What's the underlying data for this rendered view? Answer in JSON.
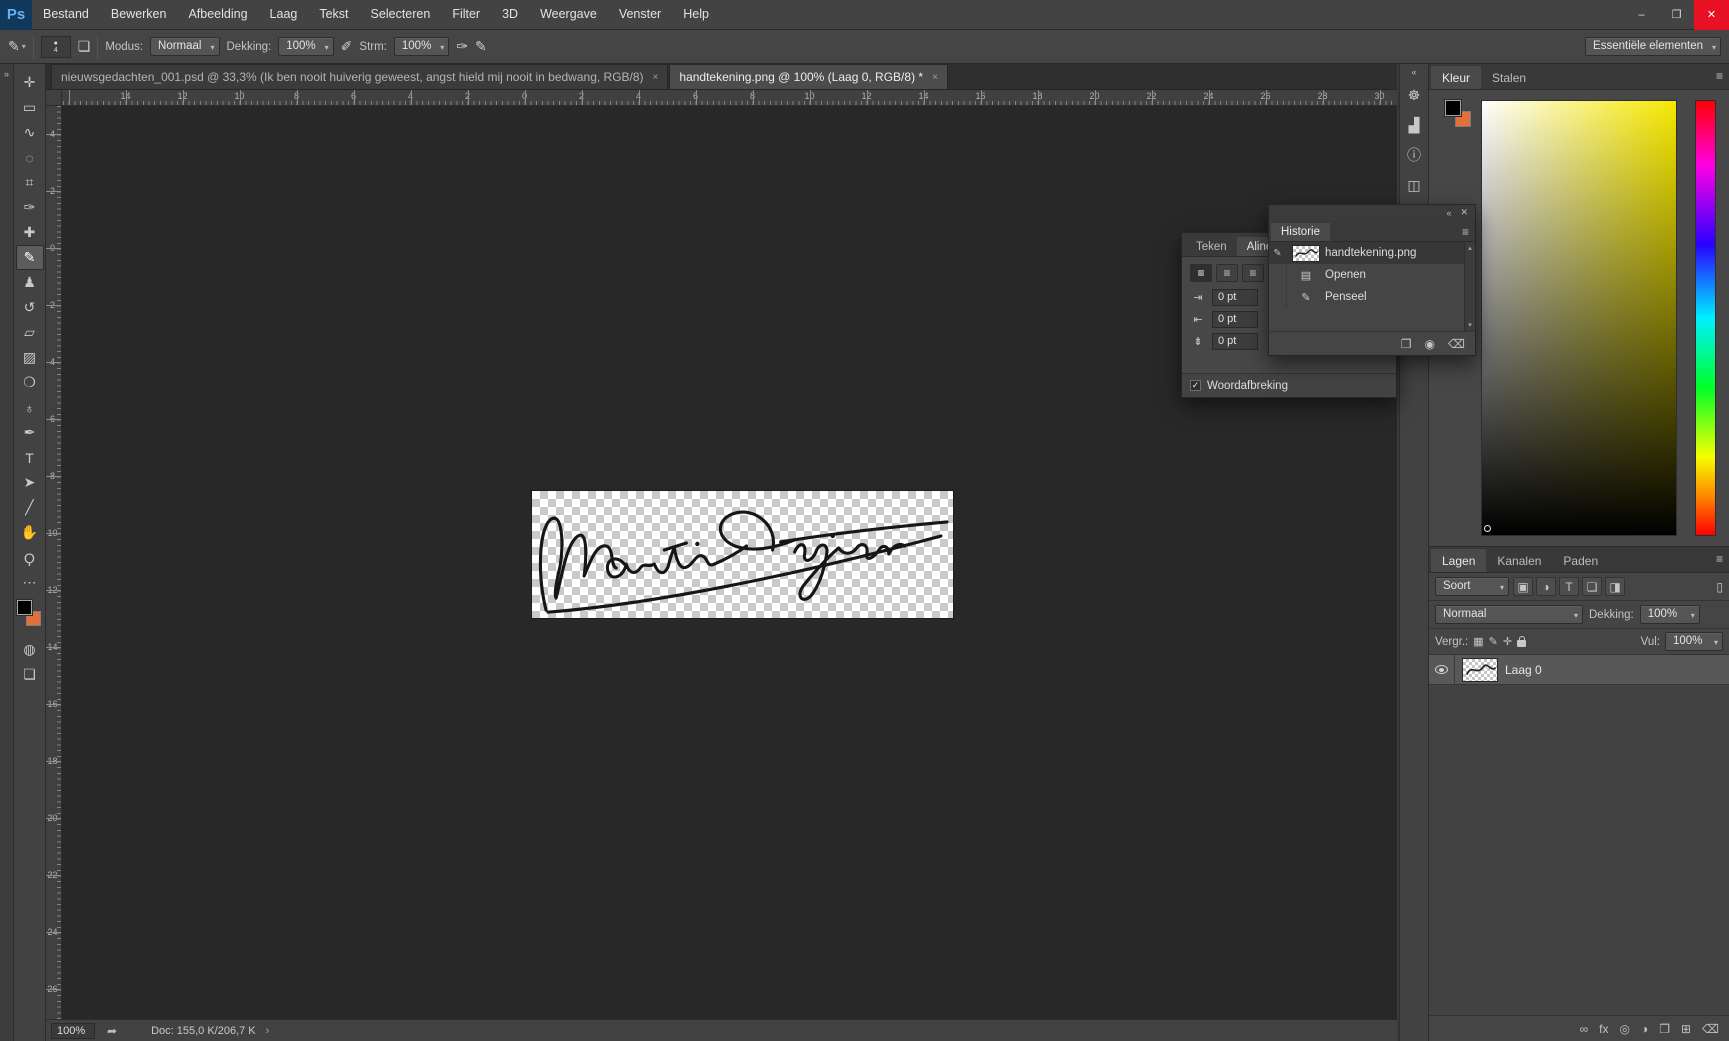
{
  "window": {
    "logo": "Ps",
    "minimize": "–",
    "maximize": "❐",
    "close": "✕"
  },
  "menubar": {
    "items": [
      "Bestand",
      "Bewerken",
      "Afbeelding",
      "Laag",
      "Tekst",
      "Selecteren",
      "Filter",
      "3D",
      "Weergave",
      "Venster",
      "Help"
    ]
  },
  "options_bar": {
    "tool_icon": "✎",
    "dropdown_arrow": "▾",
    "brush_tip_dot": "●",
    "brush_size": "4",
    "panel_toggle_icon": "❏",
    "mode_label": "Modus:",
    "mode_value": "Normaal",
    "opacity_label": "Dekking:",
    "opacity_value": "100%",
    "tablet_opacity_icon": "✐",
    "flow_label": "Strm:",
    "flow_value": "100%",
    "airbrush_icon": "✑",
    "tablet_size_icon": "✎",
    "workspace_value": "Essentiële elementen"
  },
  "document_tabs": [
    {
      "label": "nieuwsgedachten_001.psd @ 33,3% (Ik ben nooit huiverig geweest, angst hield mij nooit in bedwang, RGB/8)",
      "close": "×",
      "active": false
    },
    {
      "label": "handtekening.png @ 100% (Laag 0, RGB/8) *",
      "close": "×",
      "active": true
    }
  ],
  "rulers": {
    "horizontal": [
      "14",
      "12",
      "10",
      "8",
      "6",
      "4",
      "2",
      "0",
      "2",
      "4",
      "6",
      "8",
      "10",
      "12",
      "14",
      "16",
      "18",
      "20",
      "22",
      "24",
      "26",
      "28",
      "30"
    ],
    "vertical": [
      "4",
      "2",
      "0",
      "2",
      "4",
      "6",
      "8",
      "10",
      "12",
      "14",
      "16",
      "18",
      "20",
      "22",
      "24",
      "26"
    ]
  },
  "panel_strips": {
    "left_expand": "»",
    "right_collapse": "«"
  },
  "tools": [
    {
      "name": "move-tool",
      "glyph": "✛"
    },
    {
      "name": "marquee-tool",
      "glyph": "▭"
    },
    {
      "name": "lasso-tool",
      "glyph": "∿"
    },
    {
      "name": "quick-selection-tool",
      "glyph": "◌"
    },
    {
      "name": "crop-tool",
      "glyph": "⌗"
    },
    {
      "name": "eyedropper-tool",
      "glyph": "✑"
    },
    {
      "name": "healing-brush-tool",
      "glyph": "✚"
    },
    {
      "name": "brush-tool",
      "glyph": "✎",
      "active": true
    },
    {
      "name": "clone-stamp-tool",
      "glyph": "♟"
    },
    {
      "name": "history-brush-tool",
      "glyph": "↺"
    },
    {
      "name": "eraser-tool",
      "glyph": "▱"
    },
    {
      "name": "gradient-tool",
      "glyph": "▨"
    },
    {
      "name": "blur-tool",
      "glyph": "❍"
    },
    {
      "name": "dodge-tool",
      "glyph": "♁"
    },
    {
      "name": "pen-tool",
      "glyph": "✒"
    },
    {
      "name": "type-tool",
      "glyph": "T"
    },
    {
      "name": "path-selection-tool",
      "glyph": "➤"
    },
    {
      "name": "line-tool",
      "glyph": "╱"
    },
    {
      "name": "hand-tool",
      "glyph": "✋"
    },
    {
      "name": "zoom-tool",
      "glyph": "Ϙ"
    },
    {
      "name": "edit-toolbar-button",
      "glyph": "⋯"
    }
  ],
  "tools_bottom": [
    {
      "name": "quick-mask-button",
      "glyph": "◍"
    },
    {
      "name": "screen-mode-button",
      "glyph": "❏"
    }
  ],
  "colors": {
    "foreground": "#000000",
    "background": "#e2703a",
    "close_button": "#e81123",
    "canvas": "#282828"
  },
  "dock_icons": [
    {
      "name": "navigator-panel-icon",
      "glyph": "☸"
    },
    {
      "name": "histogram-panel-icon",
      "glyph": "▟"
    },
    {
      "name": "info-panel-icon",
      "glyph": "ⓘ"
    },
    {
      "name": "properties-panel-icon",
      "glyph": "◫"
    }
  ],
  "color_panel": {
    "tabs": [
      {
        "label": "Kleur",
        "active": true
      },
      {
        "label": "Stalen"
      }
    ],
    "menu_icon": "≡",
    "hue_color": "#f6e800"
  },
  "layers_panel": {
    "tabs": [
      {
        "label": "Lagen",
        "active": true
      },
      {
        "label": "Kanalen"
      },
      {
        "label": "Paden"
      }
    ],
    "menu_icon": "≡",
    "filter_label": "Soort",
    "dropdown_arrow": "▾",
    "filter_icons": [
      {
        "name": "filter-pixel-layers-icon",
        "glyph": "▣"
      },
      {
        "name": "filter-adjustment-layers-icon",
        "glyph": "◑"
      },
      {
        "name": "filter-type-layers-icon",
        "glyph": "T"
      },
      {
        "name": "filter-shape-layers-icon",
        "glyph": "❏"
      },
      {
        "name": "filter-smart-objects-icon",
        "glyph": "◨"
      }
    ],
    "filter_toggle_icon": "▯",
    "blend_mode_value": "Normaal",
    "opacity_label": "Dekking:",
    "opacity_value": "100%",
    "lock_label": "Vergr.:",
    "lock_glyphs": [
      "▦",
      "✎",
      "✛"
    ],
    "fill_label": "Vul:",
    "fill_value": "100%",
    "layers": [
      {
        "name": "Laag 0"
      }
    ],
    "bottom_buttons": [
      {
        "name": "link-layers-button",
        "glyph": "∞"
      },
      {
        "name": "layer-effects-button",
        "glyph": "fx"
      },
      {
        "name": "layer-mask-button",
        "glyph": "◎"
      },
      {
        "name": "adjustment-layer-button",
        "glyph": "◑"
      },
      {
        "name": "layer-group-button",
        "glyph": "❐"
      },
      {
        "name": "new-layer-button",
        "glyph": "⊞"
      },
      {
        "name": "delete-layer-button",
        "glyph": "⌫"
      }
    ]
  },
  "paragraph_panel": {
    "tabs": [
      {
        "label": "Teken"
      },
      {
        "label": "Alinea",
        "active": true
      }
    ],
    "align_buttons": [
      {
        "name": "align-left-button",
        "glyph": "≡",
        "active": true
      },
      {
        "name": "align-center-button",
        "glyph": "≡"
      },
      {
        "name": "align-right-button",
        "glyph": "≡"
      }
    ],
    "fields": [
      {
        "name": "indent-left-field",
        "icon": "⇥",
        "value": "0 pt"
      },
      {
        "name": "indent-right-field",
        "icon": "⇤",
        "value": "0 pt"
      },
      {
        "name": "space-before-field",
        "icon": "⇟",
        "value": "0 pt"
      }
    ],
    "hyphenate_label": "Woordafbreking",
    "checkmark": "✓"
  },
  "history_panel": {
    "collapse_icon": "«",
    "close_icon": "✕",
    "title": "Historie",
    "menu_icon": "≡",
    "entries": [
      {
        "label": "handtekening.png",
        "slot_icon": "✎",
        "selected": true
      },
      {
        "label": "Openen",
        "item_icon": "▤"
      },
      {
        "label": "Penseel",
        "item_icon": "✎"
      }
    ],
    "scroll_up": "▴",
    "scroll_down": "▾",
    "new_doc_icon": "❐",
    "snapshot_icon": "◉",
    "delete_icon": "⌫"
  },
  "status_bar": {
    "zoom": "100%",
    "publish_icon": "➦",
    "doc_info": "Doc: 155,0 K/206,7 K",
    "chevron": "›"
  },
  "canvas": {
    "signature_text": "Martin Gijzemijter"
  }
}
